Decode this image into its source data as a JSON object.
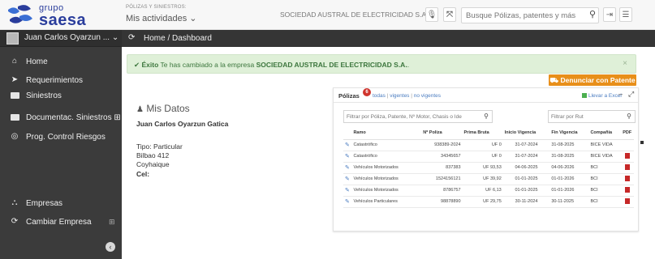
{
  "brand": {
    "grupo": "grupo",
    "saesa": "saesa"
  },
  "module": {
    "subtitle": "PÓLIZAS Y SINIESTROS:",
    "selector": "Mis actividades ⌄"
  },
  "company_name": "SOCIEDAD AUSTRAL DE ELECTRICIDAD S.A.",
  "search": {
    "placeholder": "Busque Pólizas, patentes y más"
  },
  "user": {
    "name": "Juan Carlos Oyarzun ... ⌄"
  },
  "sidebar": {
    "items": [
      {
        "label": "Home"
      },
      {
        "label": "Requerimientos"
      },
      {
        "label": "Siniestros"
      },
      {
        "label": "Documentac. Siniestros ⊞"
      },
      {
        "label": "Prog. Control Riesgos"
      },
      {
        "label": "Empresas"
      },
      {
        "label": "Cambiar Empresa"
      }
    ],
    "expand_symbol": "⊞"
  },
  "breadcrumb": {
    "text": "Home / Dashboard"
  },
  "alert": {
    "strong": "Éxito",
    "text": " Te has cambiado a la empresa ",
    "company": "SOCIEDAD AUSTRAL DE ELECTRICIDAD S.A.",
    "end": ".",
    "close": "×"
  },
  "mis_datos": {
    "title": "Mis Datos",
    "name": "Juan Carlos Oyarzun Gatica",
    "tipo": "Tipo: Particular",
    "address1": "Bilbao 412",
    "address2": "Coyhaique",
    "cel_label": "Cel:"
  },
  "denunciar": {
    "label": "Denunciar con Patente"
  },
  "polizas": {
    "title": "Pólizas",
    "count": "6",
    "filter_todas": "todas",
    "filter_vigentes": "vigentes",
    "filter_no_vigentes": "no vigentes",
    "excel": "Llevar a Excel",
    "filter_placeholder": "Filtrar por Póliza, Patente, Nº Motor, Chasis o Ide",
    "rut_placeholder": "Filtrar por Rut",
    "columns": [
      "Ramo",
      "Nº Poliza",
      "Prima Bruta",
      "Inicio Vigencia",
      "Fin Vigencia",
      "Compañía",
      "PDF"
    ],
    "rows": [
      {
        "ramo": "Catastrófico",
        "poliza": "938389-2024",
        "prima": "UF 0",
        "inicio": "31-07-2024",
        "fin": "31-08-2025",
        "compania": "BICE VIDA",
        "pdf": false
      },
      {
        "ramo": "Catastrófico",
        "poliza": "34345657",
        "prima": "UF 0",
        "inicio": "31-07-2024",
        "fin": "31-08-2025",
        "compania": "BICE VIDA",
        "pdf": true
      },
      {
        "ramo": "Vehículos Motorizados",
        "poliza": "837383",
        "prima": "UF 93,53",
        "inicio": "04-06-2025",
        "fin": "04-06-2026",
        "compania": "BCI",
        "pdf": true
      },
      {
        "ramo": "Vehículos Motorizados",
        "poliza": "1524156121",
        "prima": "UF 39,92",
        "inicio": "01-01-2025",
        "fin": "01-01-2026",
        "compania": "BCI",
        "pdf": true
      },
      {
        "ramo": "Vehículos Motorizados",
        "poliza": "8786757",
        "prima": "UF 6,13",
        "inicio": "01-01-2025",
        "fin": "01-01-2026",
        "compania": "BCI",
        "pdf": true
      },
      {
        "ramo": "Vehículos Particulares",
        "poliza": "98878890",
        "prima": "UF 29,75",
        "inicio": "30-11-2024",
        "fin": "30-11-2025",
        "compania": "BCI",
        "pdf": true
      }
    ]
  },
  "colors": {
    "sidebar": "#3b3b3b",
    "brand": "#2a3d9c",
    "accent": "#e88f1a",
    "success_bg": "#dff0d8",
    "badge": "#d0352e"
  }
}
